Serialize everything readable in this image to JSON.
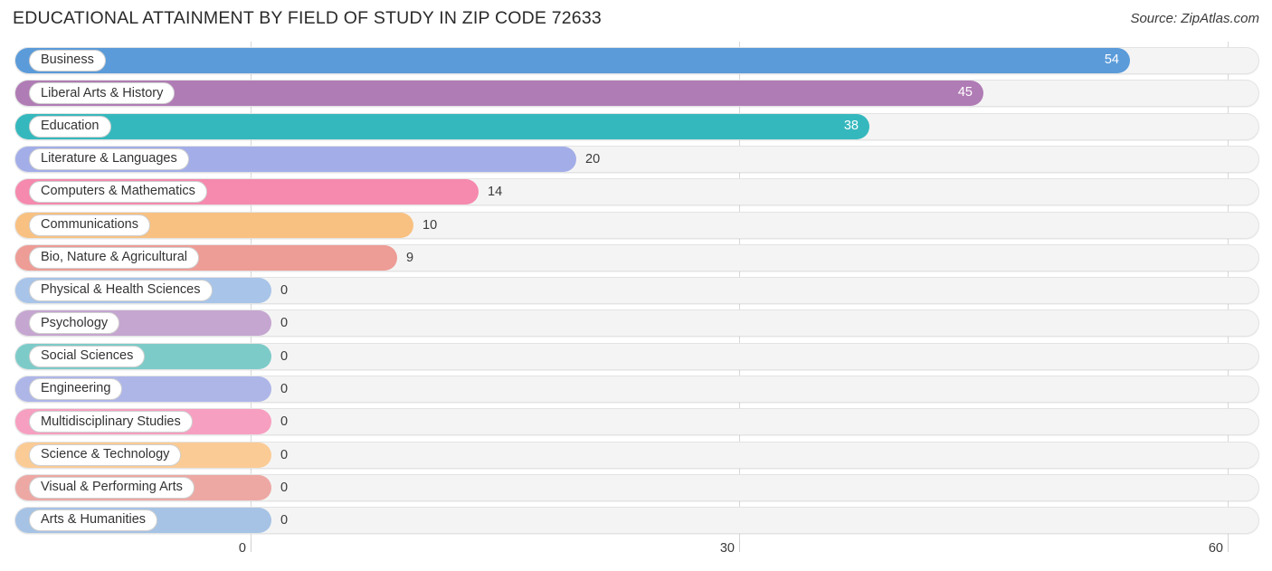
{
  "header": {
    "title": "EDUCATIONAL ATTAINMENT BY FIELD OF STUDY IN ZIP CODE 72633",
    "source": "Source: ZipAtlas.com"
  },
  "chart_data": {
    "type": "bar",
    "orientation": "horizontal",
    "title": "EDUCATIONAL ATTAINMENT BY FIELD OF STUDY IN ZIP CODE 72633",
    "xlabel": "",
    "ylabel": "",
    "xlim": [
      0,
      60
    ],
    "xticks": [
      0,
      30,
      60
    ],
    "xtick_labels": [
      "0",
      "30",
      "60"
    ],
    "grid": true,
    "legend": false,
    "categories": [
      "Business",
      "Liberal Arts & History",
      "Education",
      "Literature & Languages",
      "Computers & Mathematics",
      "Communications",
      "Bio, Nature & Agricultural",
      "Physical & Health Sciences",
      "Psychology",
      "Social Sciences",
      "Engineering",
      "Multidisciplinary Studies",
      "Science & Technology",
      "Visual & Performing Arts",
      "Arts & Humanities"
    ],
    "values": [
      54,
      45,
      38,
      20,
      14,
      10,
      9,
      0,
      0,
      0,
      0,
      0,
      0,
      0,
      0
    ],
    "value_labels": [
      "54",
      "45",
      "38",
      "20",
      "14",
      "10",
      "9",
      "0",
      "0",
      "0",
      "0",
      "0",
      "0",
      "0",
      "0"
    ],
    "colors": [
      "#5b9bd9",
      "#b07cb5",
      "#35b8bd",
      "#a3aee8",
      "#f589ae",
      "#f8c182",
      "#ee9c96",
      "#a8c4e8",
      "#c5a6d0",
      "#7dcbc9",
      "#aeb6e8",
      "#f79fc0",
      "#fbcb95",
      "#eda8a4",
      "#a6c3e5"
    ]
  }
}
